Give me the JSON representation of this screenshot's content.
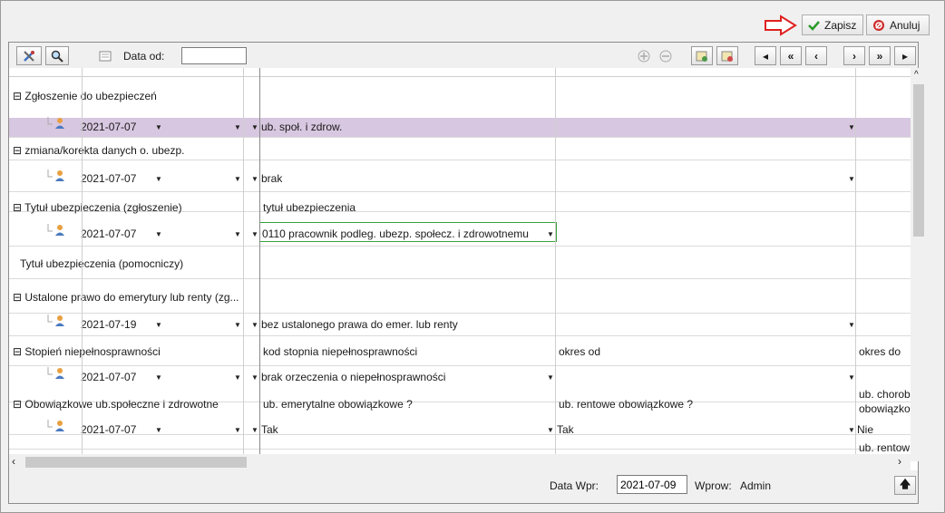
{
  "actions": {
    "save_label": "Zapisz",
    "cancel_label": "Anuluj"
  },
  "toolbar": {
    "date_from_label": "Data od:",
    "date_from_value": ""
  },
  "rows": [
    {
      "type": "group",
      "label": "⊟ Zgłoszenie do ubezpieczeń"
    },
    {
      "type": "entry",
      "date": "2021-07-07",
      "value1": "ub. społ. i zdrow.",
      "selected": true
    },
    {
      "type": "group",
      "label": "⊟ zmiana/korekta danych o. ubezp."
    },
    {
      "type": "entry",
      "date": "2021-07-07",
      "value1": "brak"
    },
    {
      "type": "group",
      "label": "⊟ Tytuł ubezpieczenia (zgłoszenie)",
      "h1": "tytuł ubezpieczenia"
    },
    {
      "type": "entry",
      "date": "2021-07-07",
      "value1": "0110 pracownik podleg. ubezp. społecz. i zdrowotnemu"
    },
    {
      "type": "group",
      "label": "Tytuł ubezpieczenia (pomocniczy)"
    },
    {
      "type": "group",
      "label": "⊟ Ustalone prawo do emerytury lub renty (zg..."
    },
    {
      "type": "entry",
      "date": "2021-07-19",
      "value1": "bez ustalonego prawa do emer. lub renty"
    },
    {
      "type": "group",
      "label": "⊟ Stopień niepełnosprawności",
      "h1": "kod stopnia niepełnosprawności",
      "h2": "okres od",
      "h3": "okres do"
    },
    {
      "type": "entry",
      "date": "2021-07-07",
      "value1": "brak orzeczenia o niepełnosprawności",
      "value2": ""
    },
    {
      "type": "group",
      "label": "⊟ Obowiązkowe ub.społeczne i zdrowotne",
      "h1": "ub. emerytalne obowiązkowe ?",
      "h2": "ub. rentowe obowiązkowe ?",
      "h3a": "ub. chorob",
      "h3b": "obowiązko"
    },
    {
      "type": "entry",
      "date": "2021-07-07",
      "value1": "Tak",
      "value2": "Tak",
      "value3": "Nie"
    }
  ],
  "partial_row": {
    "h3": "ub. rentow"
  },
  "status": {
    "date_label": "Data Wpr:",
    "date_value": "2021-07-09",
    "user_label": "Wprow:",
    "user_value": "Admin"
  },
  "icons": {
    "save": "check-icon",
    "cancel": "cancel-icon",
    "arrow": "arrow-right-icon",
    "tools": "tools-icon",
    "search": "search-icon",
    "card": "card-icon",
    "add": "add-icon",
    "remove": "remove-icon",
    "export": "export-icon",
    "import": "import-icon",
    "first": "first-icon",
    "prev-page": "prev-page-icon",
    "prev": "prev-icon",
    "next": "next-icon",
    "next-page": "next-page-icon",
    "last": "last-icon",
    "up": "up-arrow-icon"
  }
}
